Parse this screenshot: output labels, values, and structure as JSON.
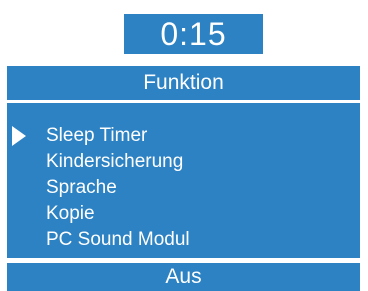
{
  "timer": {
    "value": "0:15"
  },
  "header": {
    "title": "Funktion"
  },
  "menu": {
    "selected_index": 0,
    "items": [
      {
        "label": "Sleep Timer"
      },
      {
        "label": "Kindersicherung"
      },
      {
        "label": "Sprache"
      },
      {
        "label": "Kopie"
      },
      {
        "label": "PC Sound Modul"
      }
    ]
  },
  "footer": {
    "value": "Aus"
  },
  "colors": {
    "panel_background": "#2c82c3",
    "text": "#ffffff",
    "page_background": "#ffffff"
  },
  "icons": {
    "selector": "triangle-right-icon"
  }
}
